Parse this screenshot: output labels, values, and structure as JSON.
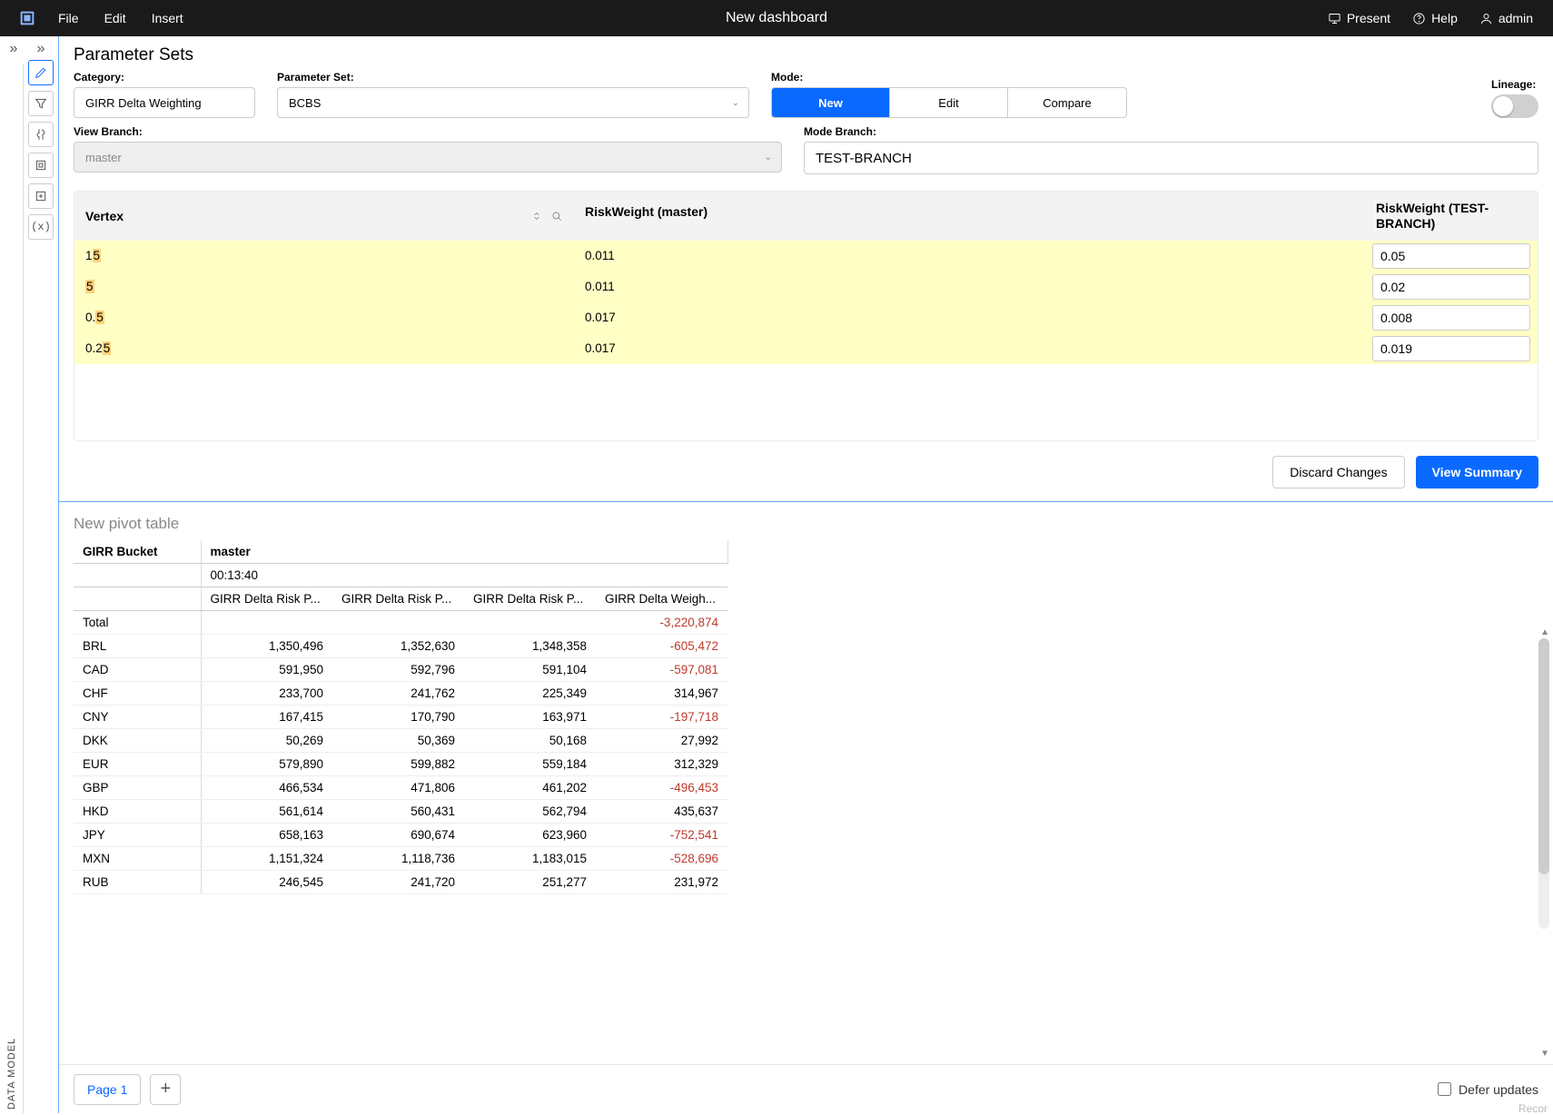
{
  "app": {
    "title": "New dashboard",
    "menu": {
      "file": "File",
      "edit": "Edit",
      "insert": "Insert"
    },
    "right": {
      "present": "Present",
      "help": "Help",
      "user": "admin"
    }
  },
  "rail_label": "DATA MODEL",
  "param": {
    "title": "Parameter Sets",
    "category_label": "Category:",
    "category_value": "GIRR Delta Weighting",
    "pset_label": "Parameter Set:",
    "pset_value": "BCBS",
    "mode_label": "Mode:",
    "modes": {
      "new": "New",
      "edit": "Edit",
      "compare": "Compare"
    },
    "lineage_label": "Lineage:",
    "view_branch_label": "View Branch:",
    "view_branch_value": "master",
    "mode_branch_label": "Mode Branch:",
    "mode_branch_value": "TEST-BRANCH",
    "table": {
      "head_vertex": "Vertex",
      "head_master": "RiskWeight (master)",
      "head_branch": "RiskWeight (TEST-BRANCH)",
      "rows": [
        {
          "v_pre": "1",
          "v_hl": "5",
          "master": "0.011",
          "branch": "0.05"
        },
        {
          "v_pre": "",
          "v_hl": "5",
          "master": "0.011",
          "branch": "0.02"
        },
        {
          "v_pre": "0.",
          "v_hl": "5",
          "master": "0.017",
          "branch": "0.008"
        },
        {
          "v_pre": "0.2",
          "v_hl": "5",
          "master": "0.017",
          "branch": "0.019"
        }
      ]
    },
    "discard": "Discard Changes",
    "view_summary": "View Summary"
  },
  "pivot": {
    "title": "New pivot table",
    "bucket_label": "GIRR Bucket",
    "branch": "master",
    "time": "00:13:40",
    "cols": [
      "GIRR Delta Risk P...",
      "GIRR Delta Risk P...",
      "GIRR Delta Risk P...",
      "GIRR Delta Weigh..."
    ],
    "total_label": "Total",
    "total_row": [
      "",
      "",
      "",
      "-3,220,874"
    ],
    "rows": [
      {
        "k": "BRL",
        "v": [
          "1,350,496",
          "1,352,630",
          "1,348,358",
          "-605,472"
        ]
      },
      {
        "k": "CAD",
        "v": [
          "591,950",
          "592,796",
          "591,104",
          "-597,081"
        ]
      },
      {
        "k": "CHF",
        "v": [
          "233,700",
          "241,762",
          "225,349",
          "314,967"
        ]
      },
      {
        "k": "CNY",
        "v": [
          "167,415",
          "170,790",
          "163,971",
          "-197,718"
        ]
      },
      {
        "k": "DKK",
        "v": [
          "50,269",
          "50,369",
          "50,168",
          "27,992"
        ]
      },
      {
        "k": "EUR",
        "v": [
          "579,890",
          "599,882",
          "559,184",
          "312,329"
        ]
      },
      {
        "k": "GBP",
        "v": [
          "466,534",
          "471,806",
          "461,202",
          "-496,453"
        ]
      },
      {
        "k": "HKD",
        "v": [
          "561,614",
          "560,431",
          "562,794",
          "435,637"
        ]
      },
      {
        "k": "JPY",
        "v": [
          "658,163",
          "690,674",
          "623,960",
          "-752,541"
        ]
      },
      {
        "k": "MXN",
        "v": [
          "1,151,324",
          "1,118,736",
          "1,183,015",
          "-528,696"
        ]
      },
      {
        "k": "RUB",
        "v": [
          "246,545",
          "241,720",
          "251,277",
          "231,972"
        ]
      }
    ]
  },
  "footer": {
    "page": "Page 1",
    "defer": "Defer updates",
    "recor": "Recor"
  }
}
